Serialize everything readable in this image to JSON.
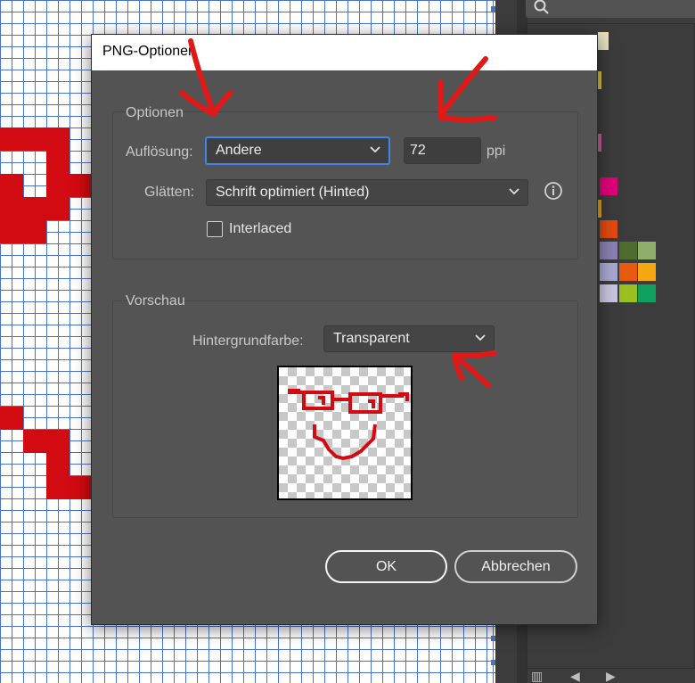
{
  "dialog": {
    "title": "PNG-Optionen",
    "options_group": {
      "title": "Optionen",
      "resolution_label": "Auflösung:",
      "resolution_value": "Andere",
      "ppi_value": "72",
      "ppi_unit": "ppi",
      "smoothing_label": "Glätten:",
      "smoothing_value": "Schrift optimiert (Hinted)",
      "interlaced_label": "Interlaced",
      "interlaced_checked": false
    },
    "preview_group": {
      "title": "Vorschau",
      "background_label": "Hintergrundfarbe:",
      "background_value": "Transparent"
    },
    "ok_label": "OK",
    "cancel_label": "Abbrechen"
  },
  "icons": {
    "search": "search-icon",
    "info": "info-icon",
    "dropdown": "chevron-down-icon"
  },
  "colors": {
    "dialog_bg": "#535353",
    "focus_blue": "#3f86e6",
    "artwork_red": "#d20a11",
    "annotation_red": "#e01818"
  }
}
